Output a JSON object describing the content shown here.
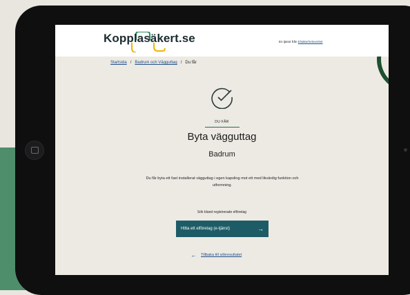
{
  "header": {
    "logo_text": "Kopplasäkert.se",
    "tagline_prefix": "En tjänst från",
    "tagline_link": "Elsäkerhetsverket"
  },
  "breadcrumb": {
    "home": "Startsida",
    "category": "Badrum och Vägguttag",
    "current": "Du får",
    "separator": "/"
  },
  "result": {
    "eyebrow": "DU FÅR",
    "title": "Byta vägguttag",
    "subtitle": "Badrum",
    "description": "Du får byta ett fast installerat vägguttag i egen kapsling mot ett med likvärdig funktion och utformning.",
    "search_label": "Sök bland registrerade elföretag",
    "cta_label": "Hitta ett elföretag (e-tjänst)",
    "back_label": "Tillbaka till sökresultatet"
  },
  "colors": {
    "brand_dark_green": "#1d5c66",
    "accent_green": "#2d6a4f",
    "accent_yellow": "#f0b400",
    "link_blue": "#1e4f86"
  },
  "icons": {
    "check": "check-circle-icon",
    "arrow_right": "arrow-right-icon",
    "arrow_left": "arrow-left-icon",
    "home_button": "home-button-icon"
  }
}
